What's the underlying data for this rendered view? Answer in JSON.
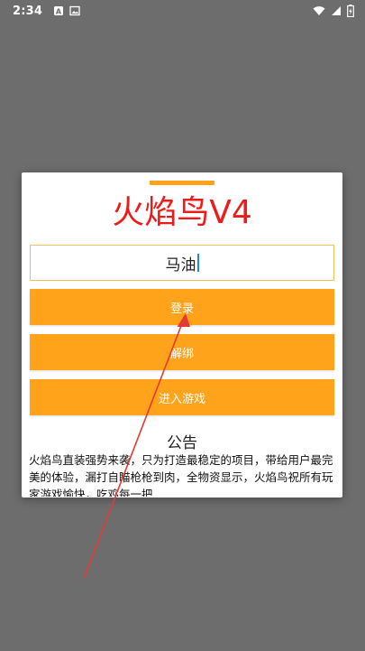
{
  "status_bar": {
    "time": "2:34",
    "left_icons": [
      "app-a-icon",
      "image-icon"
    ],
    "right_icons": [
      "wifi-icon",
      "signal-icon",
      "battery-charging-icon"
    ]
  },
  "dialog": {
    "title": "火焰鸟V4",
    "input": {
      "value": "马油",
      "placeholder": ""
    },
    "buttons": {
      "login": "登录",
      "unbind": "解绑",
      "enter_game": "进入游戏"
    },
    "notice": {
      "heading": "公告",
      "text": "火焰鸟直装强势来袭，只为打造最稳定的项目，带给用户最完美的体验，漏打自瞄枪枪到肉，全物资显示，火焰鸟祝所有玩家游戏愉快，吃鸡每一把"
    }
  },
  "colors": {
    "accent": "#ffa31a",
    "title": "#ef1a1a",
    "overlay": "#6d6d6d",
    "arrow": "#e53935"
  }
}
